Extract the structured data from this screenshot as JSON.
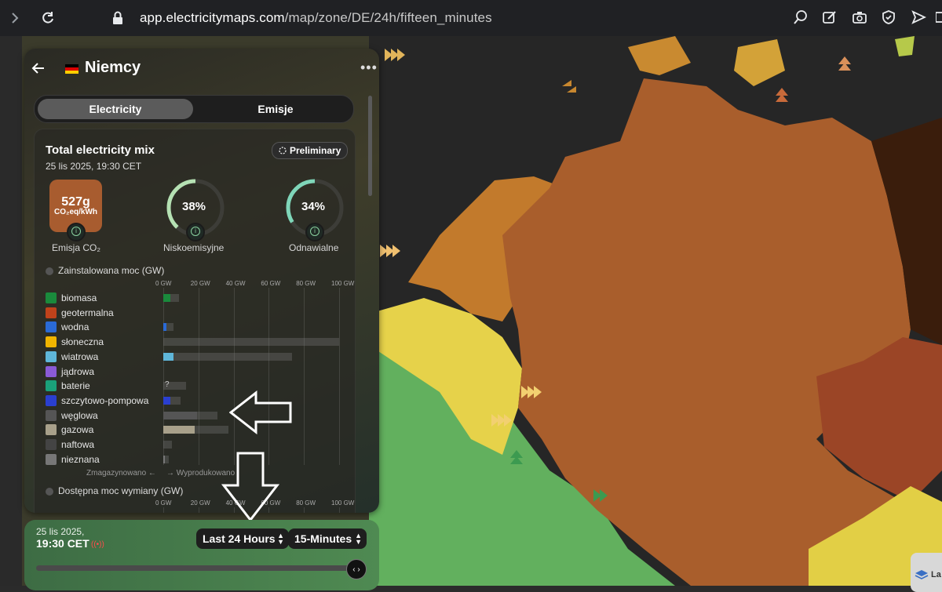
{
  "browser": {
    "url_host": "app.electricitymaps.com",
    "url_path": "/map/zone/DE/24h/fifteen_minutes"
  },
  "panel": {
    "zone_name": "Niemcy",
    "tabs": [
      "Electricity",
      "Emisje"
    ],
    "card": {
      "title": "Total electricity mix",
      "date": "25 lis 2025, 19:30 CET",
      "badge": "Preliminary",
      "co2_value": "527g",
      "co2_unit": "CO₂eq/kWh",
      "co2_label": "Emisja CO₂",
      "lowcarbon_value": "38%",
      "lowcarbon_label": "Niskoemisyjne",
      "renewable_value": "34%",
      "renewable_label": "Odnawialne",
      "lowcarbon_fraction": 0.38,
      "renewable_fraction": 0.34,
      "installed_label": "Zainstalowana moc (GW)",
      "axis_ticks": [
        "0 GW",
        "20 GW",
        "40 GW",
        "60 GW",
        "80 GW",
        "100 GW"
      ],
      "axis_max_gw": 100,
      "sources": [
        {
          "label": "biomasa",
          "icon": "leaf-icon",
          "color": "#1a8a3c",
          "produced": 4,
          "capacity": 9
        },
        {
          "label": "geotermalna",
          "icon": "geothermal-icon",
          "color": "#c0421b",
          "produced": 0,
          "capacity": 0
        },
        {
          "label": "wodna",
          "icon": "water-icon",
          "color": "#2a6ad6",
          "produced": 2,
          "capacity": 6
        },
        {
          "label": "słoneczna",
          "icon": "sun-icon",
          "color": "#f0b400",
          "produced": 0,
          "capacity": 100
        },
        {
          "label": "wiatrowa",
          "icon": "wind-icon",
          "color": "#5fb6d9",
          "produced": 6,
          "capacity": 73
        },
        {
          "label": "jądrowa",
          "icon": "atom-icon",
          "color": "#8a5ad6",
          "produced": 0,
          "capacity": 0
        },
        {
          "label": "baterie",
          "icon": "battery-icon",
          "color": "#1aa07a",
          "produced": 0,
          "capacity": 13,
          "unknown": "?"
        },
        {
          "label": "szczytowo-pompowa",
          "icon": "pump-icon",
          "color": "#2a3fd0",
          "produced": 4,
          "capacity": 10
        },
        {
          "label": "węglowa",
          "icon": "coal-icon",
          "color": "#555555",
          "produced": 19,
          "capacity": 31
        },
        {
          "label": "gazowa",
          "icon": "gas-icon",
          "color": "#a8a08a",
          "produced": 18,
          "capacity": 37
        },
        {
          "label": "naftowa",
          "icon": "oil-icon",
          "color": "#444444",
          "produced": 0,
          "capacity": 5
        },
        {
          "label": "nieznana",
          "icon": "question-icon",
          "color": "#777777",
          "produced": 1,
          "capacity": 3
        }
      ],
      "stored_label": "Zmagazynowano ←",
      "produced_label": "→ Wyprodukowano",
      "exchange_label": "Dostępna moc wymiany (GW)",
      "exchange_ticks": [
        "0 GW",
        "20 GW",
        "40 GW",
        "60 GW",
        "80 GW",
        "100 GW"
      ]
    }
  },
  "timebar": {
    "date": "25 lis 2025,",
    "time": "19:30 CET",
    "range": "Last 24 Hours",
    "resolution": "15-Minutes"
  },
  "layers_button": "La",
  "colors": {
    "panel_bg": "#2f2f28",
    "co2_box": "#a85c2f",
    "lowcarbon_ring": "#b5e1b3",
    "renewable_ring": "#7fd6b9",
    "timebar": "#4a8250"
  }
}
